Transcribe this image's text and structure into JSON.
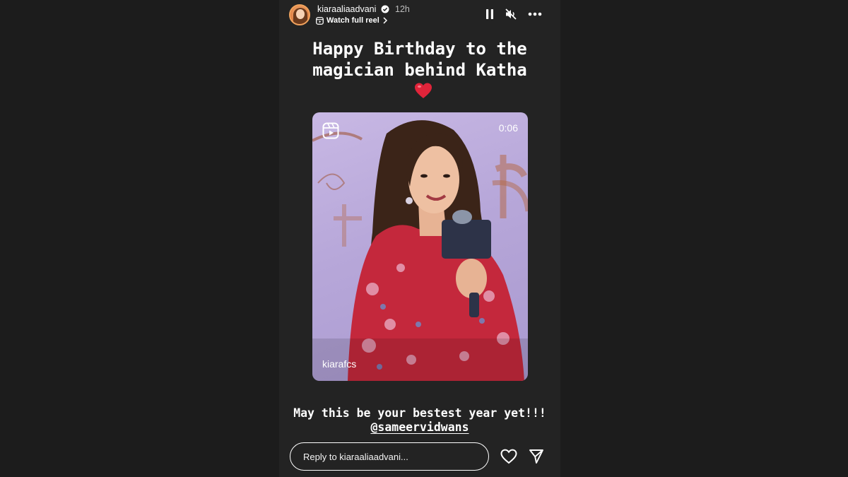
{
  "header": {
    "username": "kiaraaliaadvani",
    "time": "12h",
    "watch_label": "Watch full reel",
    "icons": {
      "verified": "verified-badge-icon",
      "pause": "pause-icon",
      "mute": "speaker-muted-icon",
      "more": "more-options-icon",
      "reel": "reel-icon",
      "chevron": "chevron-right-icon"
    }
  },
  "story": {
    "caption_line1": "Happy Birthday to the",
    "caption_line2": "magician behind Katha",
    "caption_emoji": "red-heart-emoji",
    "reel": {
      "duration": "0:06",
      "creator": "kiarafcs"
    },
    "bottom_line1": "May this be your bestest year yet!!!",
    "mention": "@sameervidwans"
  },
  "footer": {
    "reply_placeholder": "Reply to kiaraaliaadvani...",
    "like_icon": "heart-outline-icon",
    "share_icon": "send-icon"
  },
  "colors": {
    "page_bg": "#1c1c1c",
    "story_bg": "#232323",
    "text": "#ffffff",
    "heart": "#e0243a",
    "reel_bg": "#b7a7d9",
    "dress": "#c4283c"
  }
}
